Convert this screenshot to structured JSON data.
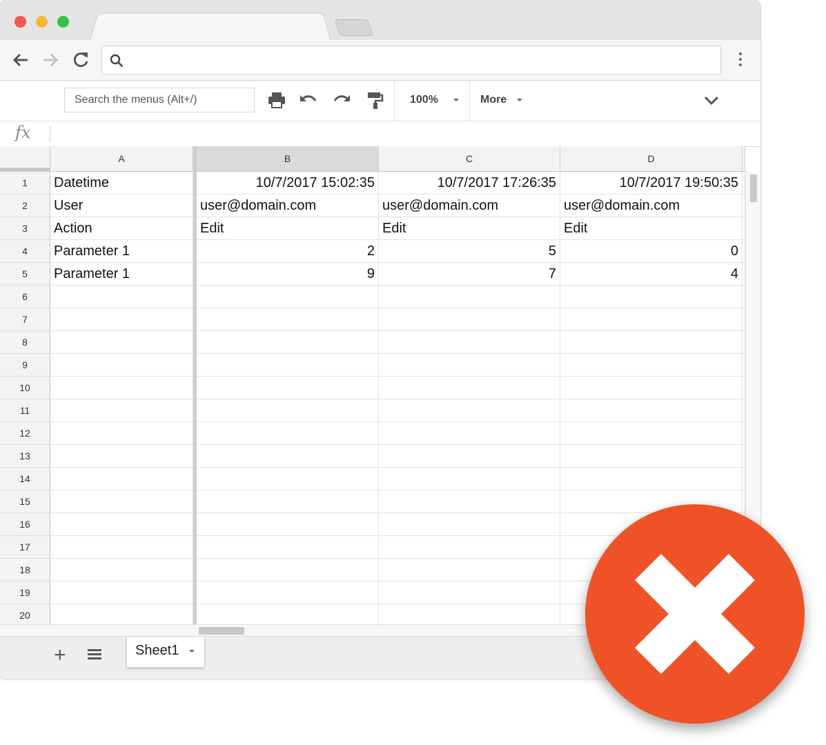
{
  "toolbar": {
    "menu_search_placeholder": "Search the menus (Alt+/)",
    "zoom": "100%",
    "more_label": "More"
  },
  "formula_bar": {
    "fx_label": "fx"
  },
  "columns": [
    "A",
    "B",
    "C",
    "D"
  ],
  "rows": [
    {
      "num": "1",
      "cells": [
        "Datetime",
        "10/7/2017 15:02:35",
        "10/7/2017 17:26:35",
        "10/7/2017 19:50:35"
      ]
    },
    {
      "num": "2",
      "cells": [
        "User",
        "user@domain.com",
        "user@domain.com",
        "user@domain.com"
      ]
    },
    {
      "num": "3",
      "cells": [
        "Action",
        "Edit",
        "Edit",
        "Edit"
      ]
    },
    {
      "num": "4",
      "cells": [
        "Parameter 1",
        "2",
        "5",
        "0"
      ]
    },
    {
      "num": "5",
      "cells": [
        "Parameter 1",
        "9",
        "7",
        "4"
      ]
    },
    {
      "num": "6",
      "cells": [
        "",
        "",
        "",
        ""
      ]
    },
    {
      "num": "7",
      "cells": [
        "",
        "",
        "",
        ""
      ]
    },
    {
      "num": "8",
      "cells": [
        "",
        "",
        "",
        ""
      ]
    },
    {
      "num": "9",
      "cells": [
        "",
        "",
        "",
        ""
      ]
    },
    {
      "num": "10",
      "cells": [
        "",
        "",
        "",
        ""
      ]
    },
    {
      "num": "11",
      "cells": [
        "",
        "",
        "",
        ""
      ]
    },
    {
      "num": "12",
      "cells": [
        "",
        "",
        "",
        ""
      ]
    },
    {
      "num": "13",
      "cells": [
        "",
        "",
        "",
        ""
      ]
    },
    {
      "num": "14",
      "cells": [
        "",
        "",
        "",
        ""
      ]
    },
    {
      "num": "15",
      "cells": [
        "",
        "",
        "",
        ""
      ]
    },
    {
      "num": "16",
      "cells": [
        "",
        "",
        "",
        ""
      ]
    },
    {
      "num": "17",
      "cells": [
        "",
        "",
        "",
        ""
      ]
    },
    {
      "num": "18",
      "cells": [
        "",
        "",
        "",
        ""
      ]
    },
    {
      "num": "19",
      "cells": [
        "",
        "",
        "",
        ""
      ]
    },
    {
      "num": "20",
      "cells": [
        "",
        "",
        "",
        ""
      ]
    }
  ],
  "sheet_tabs": [
    {
      "name": "Sheet1",
      "active": true
    }
  ],
  "icons": {
    "back": "arrow-left-icon",
    "forward": "arrow-right-icon",
    "reload": "reload-icon",
    "search": "search-icon",
    "menu": "kebab-menu-icon",
    "print": "print-icon",
    "undo": "undo-icon",
    "redo": "redo-icon",
    "paint_format": "paint-format-icon",
    "collapse": "chevron-down-icon",
    "add_sheet": "plus-icon",
    "all_sheets": "list-icon",
    "error_badge": "close-x-icon"
  },
  "colors": {
    "badge": "#ef5226",
    "selected_column_header": "#dadada"
  }
}
